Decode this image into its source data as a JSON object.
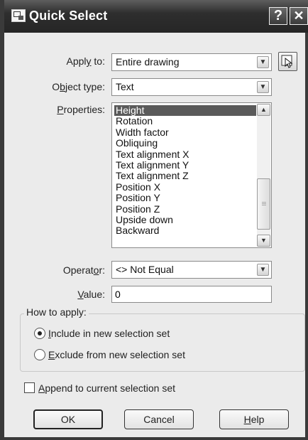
{
  "window": {
    "title": "Quick Select",
    "help_glyph": "?",
    "close_glyph": "✕"
  },
  "apply_to": {
    "label_pre": "Appl",
    "label_mn": "y",
    "label_post": " to:",
    "value": "Entire drawing"
  },
  "object_type": {
    "label_pre": "O",
    "label_mn": "b",
    "label_post": "ject type:",
    "value": "Text"
  },
  "properties": {
    "label_pre": "",
    "label_mn": "P",
    "label_post": "roperties:",
    "items": [
      "Height",
      "Rotation",
      "Width factor",
      "Obliquing",
      "Text alignment X",
      "Text alignment Y",
      "Text alignment Z",
      "Position X",
      "Position Y",
      "Position Z",
      "Upside down",
      "Backward"
    ],
    "selected": "Height"
  },
  "operator": {
    "label_pre": "Operat",
    "label_mn": "o",
    "label_post": "r:",
    "value": "<> Not Equal"
  },
  "value_field": {
    "label_pre": "",
    "label_mn": "V",
    "label_post": "alue:",
    "value": "0"
  },
  "how_to_apply": {
    "title": "How to apply:",
    "include": {
      "mn": "I",
      "rest": "nclude in new selection set",
      "selected": true
    },
    "exclude": {
      "mn": "E",
      "rest": "xclude from new selection set",
      "selected": false
    }
  },
  "append": {
    "mn": "A",
    "rest": "ppend to current selection set",
    "checked": false
  },
  "buttons": {
    "ok": "OK",
    "cancel": "Cancel",
    "help_mn": "H",
    "help_rest": "elp"
  }
}
